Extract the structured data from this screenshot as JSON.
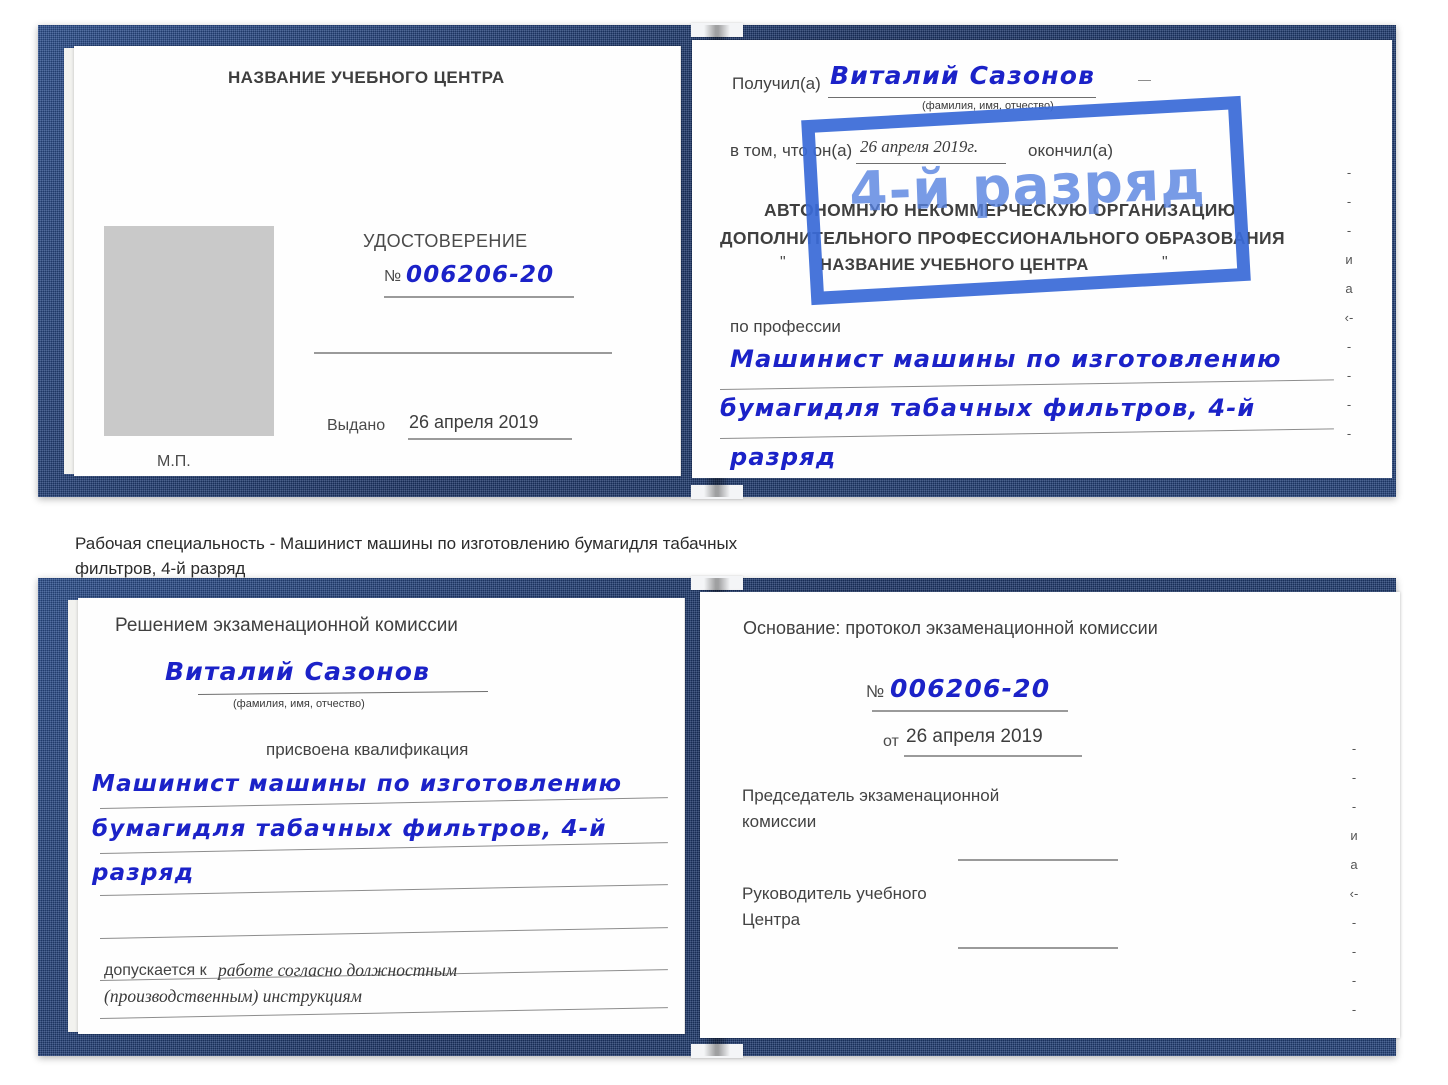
{
  "caption": {
    "line1": "Рабочая специальность - Машинист машины по изготовлению бумагидля табачных",
    "line2": "фильтров, 4-й разряд"
  },
  "colors": {
    "cover_blue": "#24437c",
    "ink_blue": "#1b22c8",
    "stamp_blue": "#3a6ad7",
    "paper": "#fefefe",
    "photo_gray": "#c9c9c9",
    "rule_gray": "#9a9a9a"
  },
  "certificate_top": {
    "left_page": {
      "heading": "НАЗВАНИЕ УЧЕБНОГО ЦЕНТРА",
      "doc_type": "УДОСТОВЕРЕНИЕ",
      "number_symbol": "№",
      "number_value": "006206-20",
      "issued_label": "Выдано",
      "issued_value": "26 апреля 2019",
      "seal_label": "М.П.",
      "photo_placeholder": "photo-placeholder"
    },
    "right_page": {
      "received_label": "Получил(а)",
      "received_value": "Виталий Сазонов",
      "fio_hint": "(фамилия, имя, отчество)",
      "that_he_label": "в том, что он(а)",
      "completion_date": "26 апреля 2019г.",
      "finished_label": "окончил(а)",
      "org_line1": "АВТОНОМНУЮ НЕКОММЕРЧЕСКУЮ ОРГАНИЗАЦИЮ",
      "org_line2": "ДОПОЛНИТЕЛЬНОГО ПРОФЕССИОНАЛЬНОГО ОБРАЗОВАНИЯ",
      "org_quote_open": "\"",
      "org_name": "НАЗВАНИЕ УЧЕБНОГО ЦЕНТРА",
      "org_quote_close": "\"",
      "profession_label": "по профессии",
      "profession_line1": "Машинист машины по изготовлению",
      "profession_line2": "бумагидля табачных фильтров, 4-й",
      "profession_line3": "разряд",
      "edge_letters": [
        "-",
        "-",
        "-",
        "и",
        "а",
        "‹-",
        "-",
        "-",
        "-",
        "-"
      ]
    },
    "stamp": {
      "text": "4-й разряд"
    }
  },
  "certificate_bottom": {
    "left_page": {
      "heading": "Решением экзаменационной комиссии",
      "name_value": "Виталий Сазонов",
      "fio_hint": "(фамилия, имя, отчество)",
      "qualification_label": "присвоена квалификация",
      "qualification_line1": "Машинист машины по изготовлению",
      "qualification_line2": "бумагидля табачных фильтров, 4-й",
      "qualification_line3": "разряд",
      "admitted_label": "допускается к",
      "admitted_value_line1": "работе согласно должностным",
      "admitted_value_line2": "(производственным) инструкциям"
    },
    "right_page": {
      "basis_label": "Основание: протокол экзаменационной комиссии",
      "number_symbol": "№",
      "number_value": "006206-20",
      "from_label": "от",
      "from_value": "26 апреля 2019",
      "chairman_line1": "Председатель экзаменационной",
      "chairman_line2": "комиссии",
      "director_line1": "Руководитель учебного",
      "director_line2": "Центра",
      "edge_letters": [
        "-",
        "-",
        "-",
        "и",
        "а",
        "‹-",
        "-",
        "-",
        "-",
        "-"
      ]
    }
  }
}
